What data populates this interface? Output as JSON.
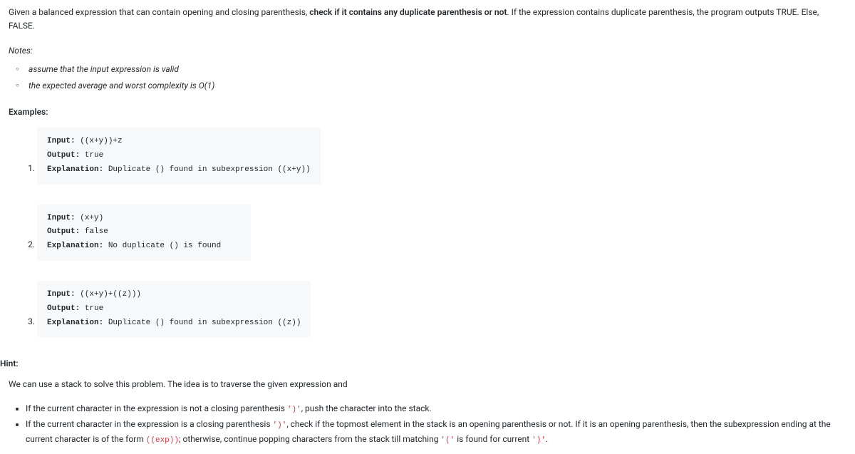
{
  "intro": {
    "pre": "Given a balanced expression that can contain opening and closing parenthesis, ",
    "bold": "check if it contains any duplicate parenthesis or not",
    "post": ". If the expression contains duplicate parenthesis, the program outputs TRUE. Else, FALSE."
  },
  "notesLabel": "Notes:",
  "notes": [
    "assume that the input expression is valid",
    "the expected average and worst complexity is O(1)"
  ],
  "examplesLabel": "Examples:",
  "examples": [
    {
      "input": "((x+y))+z",
      "output": "true",
      "explanation": "Duplicate () found in subexpression ((x+y))"
    },
    {
      "input": "(x+y)",
      "output": "false",
      "explanation": "No duplicate () is found"
    },
    {
      "input": "((x+y)+((z)))",
      "output": "true",
      "explanation": "Duplicate () found in subexpression ((z))"
    }
  ],
  "kw": {
    "input": "Input: ",
    "output": "Output:",
    "explanation": "Explanation:"
  },
  "hintLabel": "Hint:",
  "hintIntro": "We can use a stack to solve this problem. The idea is to traverse the given expression and",
  "hintItems": [
    {
      "parts": [
        {
          "t": "text",
          "v": "If the current character in the expression is not a closing parenthesis "
        },
        {
          "t": "code",
          "v": "')'"
        },
        {
          "t": "text",
          "v": ", push the character into the stack."
        }
      ]
    },
    {
      "parts": [
        {
          "t": "text",
          "v": "If the current character in the expression is a closing parenthesis "
        },
        {
          "t": "code",
          "v": "')'"
        },
        {
          "t": "text",
          "v": ", check if the topmost element in the stack is an opening parenthesis or not. If it is an opening parenthesis, then the subexpression ending at the current character is of the form "
        },
        {
          "t": "code",
          "v": "((exp))"
        },
        {
          "t": "text",
          "v": "; otherwise, continue popping characters from the stack till matching "
        },
        {
          "t": "code",
          "v": "'('"
        },
        {
          "t": "text",
          "v": " is found for current "
        },
        {
          "t": "code",
          "v": "')'"
        },
        {
          "t": "text",
          "v": "."
        }
      ]
    }
  ]
}
